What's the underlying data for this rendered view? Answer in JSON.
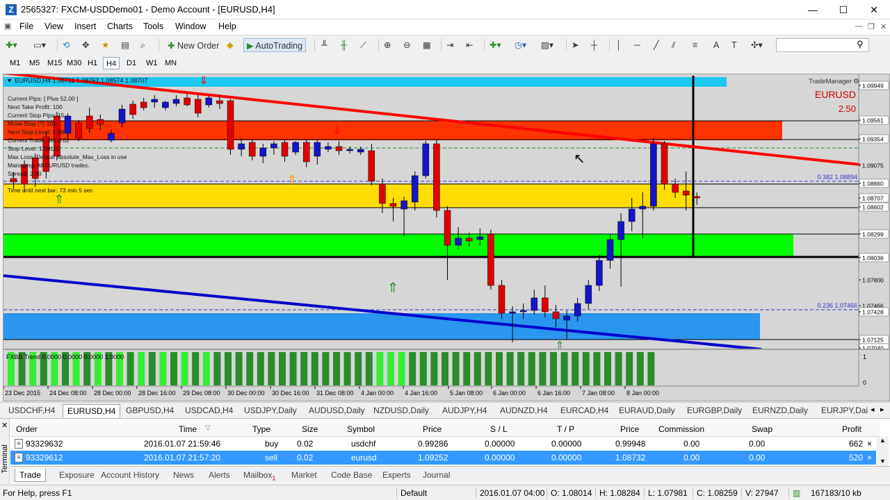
{
  "window": {
    "title": "2565327: FXCM-USDDemo01 - Demo Account - [EURUSD,H4]",
    "app_icon_letter": "Z",
    "controls": [
      "—",
      "☐",
      "✕"
    ]
  },
  "menu": {
    "items": [
      "File",
      "View",
      "Insert",
      "Charts",
      "Tools",
      "Window",
      "Help"
    ],
    "mdi_controls": [
      "—",
      "❐",
      "✕"
    ]
  },
  "toolbar": {
    "new_order_label": "New Order",
    "autotrading_label": "AutoTrading",
    "search_placeholder": ""
  },
  "timeframes": {
    "items": [
      "M1",
      "M5",
      "M15",
      "M30",
      "H1",
      "H4",
      "D1",
      "W1",
      "MN"
    ],
    "active": "H4"
  },
  "chart": {
    "header_text": "EURUSD,H4  1.08711 1.08762 1.08574 1.08707",
    "symbol": "EURUSD",
    "spread_value": "2.50",
    "trade_manager_label": "TradeManager",
    "indicator_label": "FXBB Trend 0.0000 0.0000 0.0000 1.0000",
    "info_panel": [
      "Current Pips:   [ Plus 52.00 ]",
      "Next Take Profit:   100",
      "Current Stop Pips:   15",
      "Move Stop (?)    100",
      "Next Stop Level:    1.09",
      "Current Trade:    sell 0.02",
      "Stop Level:    1.09102",
      "Max Loss:     Default Absolute_Max_Loss in use",
      "Managing: All EURUSD trades.",
      "Spread: 2.50",
      "Time until next bar:    73 min 5 sec"
    ],
    "price_labels": [
      "1.09949",
      "1.09561",
      "1.09354",
      "1.09075",
      "1.08860",
      "1.08707",
      "1.08602",
      "1.08299",
      "1.08036",
      "1.07800",
      "1.07466",
      "1.07428",
      "1.07125",
      "1.07040"
    ],
    "fib_labels": [
      "0.382  1.08894",
      "0.236  1.07466"
    ],
    "indicator_scale": [
      "1",
      "0"
    ],
    "time_labels": [
      "23 Dec 2015",
      "24 Dec 08:00",
      "28 Dec 00:00",
      "28 Dec 16:00",
      "29 Dec 08:00",
      "30 Dec 00:00",
      "30 Dec 16:00",
      "31 Dec 08:00",
      "4 Jan 00:00",
      "4 Jan 16:00",
      "5 Jan 08:00",
      "6 Jan 00:00",
      "6 Jan 16:00",
      "7 Jan 08:00",
      "8 Jan 00:00"
    ],
    "colors": {
      "bull": "#1414c8",
      "bear": "#e00000",
      "background": "#d6d6d6",
      "zone_top": "#1ec8f0",
      "zone_red": "#ff3300",
      "zone_yellow": "#ffdd00",
      "zone_green": "#00ff00",
      "zone_blue": "#2a96f0",
      "trend_red": "#ff0000",
      "trend_blue": "#0000cc",
      "indicator_dark": "#2a8c2a",
      "indicator_light": "#33ee33"
    }
  },
  "symbol_tabs": {
    "items": [
      "USDCHF,H4",
      "EURUSD,H4",
      "GBPUSD,H4",
      "USDCAD,H4",
      "USDJPY,Daily",
      "AUDUSD,Daily",
      "NZDUSD,Daily",
      "AUDJPY,H4",
      "AUDNZD,H4",
      "EURCAD,H4",
      "EURAUD,Daily",
      "EURGBP,Daily",
      "EURNZD,Daily",
      "EURJPY,Dai"
    ],
    "active_index": 1
  },
  "terminal": {
    "label": "Terminal",
    "columns": [
      "Order",
      "Time",
      "Type",
      "Size",
      "Symbol",
      "Price",
      "S / L",
      "T / P",
      "Price",
      "Commission",
      "Swap",
      "Profit"
    ],
    "sort_indicator": "▽",
    "orders": [
      {
        "order": "93329632",
        "time": "2016.01.07 21:59:46",
        "type": "buy",
        "size": "0.02",
        "symbol": "usdchf",
        "price": "0.99286",
        "sl": "0.00000",
        "tp": "0.00000",
        "cur_price": "0.99948",
        "commission": "0.00",
        "swap": "0.00",
        "profit": "662"
      },
      {
        "order": "93329612",
        "time": "2016.01.07 21:57:20",
        "type": "sell",
        "size": "0.02",
        "symbol": "eurusd",
        "price": "1.09252",
        "sl": "0.00000",
        "tp": "0.00000",
        "cur_price": "1.08732",
        "commission": "0.00",
        "swap": "0.00",
        "profit": "520"
      }
    ],
    "tabs": [
      "Trade",
      "Exposure",
      "Account History",
      "News",
      "Alerts",
      "Mailbox",
      "Market",
      "Code Base",
      "Experts",
      "Journal"
    ],
    "mailbox_badge": "1",
    "active_tab": "Trade"
  },
  "status": {
    "help": "For Help, press F1",
    "profile": "Default",
    "datetime": "2016.01.07 04:00",
    "open": "O: 1.08014",
    "high": "H: 1.08284",
    "low": "L: 1.07981",
    "close": "C: 1.08259",
    "volume": "V: 27947",
    "traffic": "167183/10 kb"
  }
}
